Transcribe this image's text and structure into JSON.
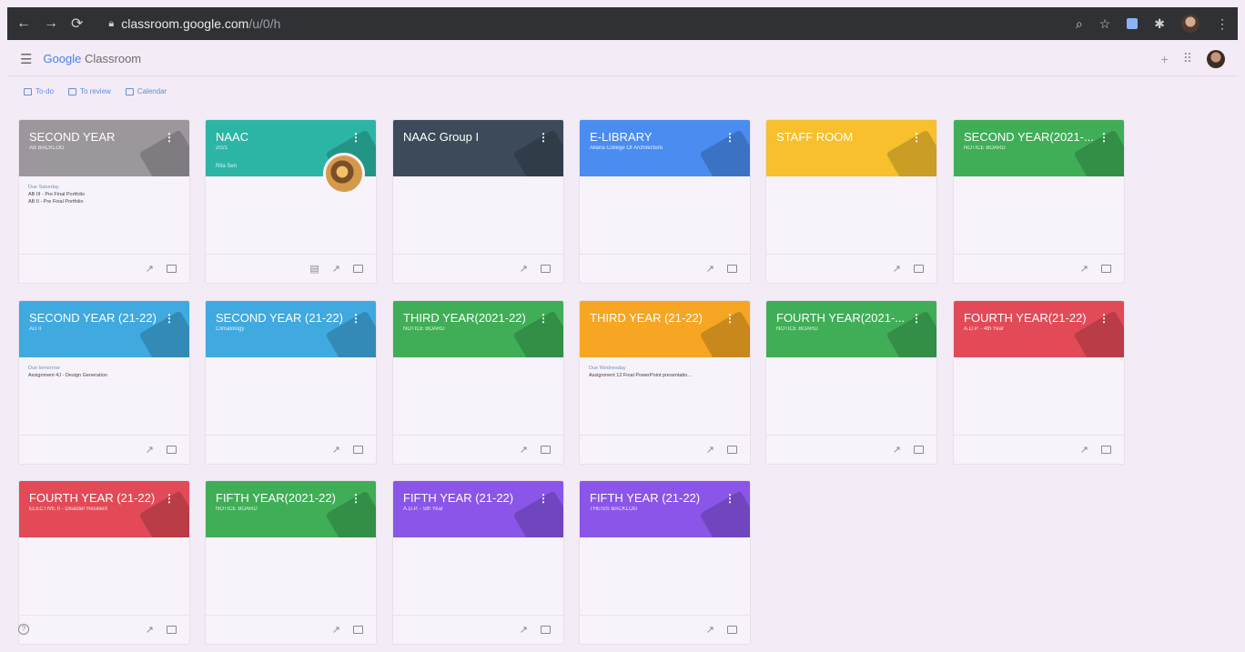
{
  "browser": {
    "url_main": "classroom.google.com",
    "url_rest": "/u/0/h"
  },
  "app": {
    "logo_google": "Google",
    "logo_classroom": "Classroom"
  },
  "subnav": {
    "todo": "To-do",
    "to_review": "To review",
    "calendar": "Calendar"
  },
  "colors": {
    "grey": "#9b979d",
    "teal": "#2cb5a5",
    "navy": "#3c4a5a",
    "blue": "#4a8cf0",
    "yellow": "#f7c02c",
    "green": "#3fae57",
    "lightblue": "#3fa9e0",
    "orange": "#f6a623",
    "red": "#e24a57",
    "purple": "#8a55e8"
  },
  "cards": [
    {
      "title": "SECOND YEAR",
      "sub": "AB BACKLOG",
      "sub2": "",
      "color": "#9b979d",
      "due": "Due Saturday",
      "lines": [
        "AB III - Pre Final Portfolio",
        "AB II - Pre Final Portfolio"
      ],
      "extra_icon": ""
    },
    {
      "title": "NAAC",
      "sub": "2021",
      "sub2": "Rita Sen",
      "color": "#2cb5a5",
      "due": "",
      "lines": [],
      "extra_icon": "assignment"
    },
    {
      "title": "NAAC Group I",
      "sub": "",
      "sub2": "",
      "color": "#3c4a5a",
      "due": "",
      "lines": [],
      "extra_icon": ""
    },
    {
      "title": "E-LIBRARY",
      "sub": "Allana College Of Architecture",
      "sub2": "",
      "color": "#4a8cf0",
      "due": "",
      "lines": [],
      "extra_icon": ""
    },
    {
      "title": "STAFF ROOM",
      "sub": "",
      "sub2": "",
      "color": "#f7c02c",
      "due": "",
      "lines": [],
      "extra_icon": ""
    },
    {
      "title": "SECOND YEAR(2021-...",
      "sub": "NOTICE BOARD",
      "sub2": "",
      "color": "#3fae57",
      "due": "",
      "lines": [],
      "extra_icon": ""
    },
    {
      "title": "SECOND YEAR (21-22)",
      "sub": "AD II",
      "sub2": "",
      "color": "#3fa9e0",
      "due": "Due tomorrow",
      "lines": [
        "Assignment 4J - Design Generation"
      ],
      "extra_icon": ""
    },
    {
      "title": "SECOND YEAR (21-22)",
      "sub": "Climatology",
      "sub2": "",
      "color": "#3fa9e0",
      "due": "",
      "lines": [],
      "extra_icon": ""
    },
    {
      "title": "THIRD YEAR(2021-22)",
      "sub": "NOTICE BOARD",
      "sub2": "",
      "color": "#3fae57",
      "due": "",
      "lines": [],
      "extra_icon": ""
    },
    {
      "title": "THIRD YEAR (21-22)",
      "sub": "",
      "sub2": "",
      "color": "#f6a623",
      "due": "Due Wednesday",
      "lines": [
        "Assignment 12 Final PowerPoint presentatio..."
      ],
      "extra_icon": ""
    },
    {
      "title": "FOURTH YEAR(2021-...",
      "sub": "NOTICE BOARD",
      "sub2": "",
      "color": "#3fae57",
      "due": "",
      "lines": [],
      "extra_icon": ""
    },
    {
      "title": "FOURTH YEAR(21-22)",
      "sub": "A.D.P. - 4th Year",
      "sub2": "",
      "color": "#e24a57",
      "due": "",
      "lines": [],
      "extra_icon": ""
    },
    {
      "title": "FOURTH YEAR (21-22)",
      "sub": "ELECTIVE II - Disaster Resilient",
      "sub2": "",
      "color": "#e24a57",
      "due": "",
      "lines": [],
      "extra_icon": ""
    },
    {
      "title": "FIFTH YEAR(2021-22)",
      "sub": "NOTICE BOARD",
      "sub2": "",
      "color": "#3fae57",
      "due": "",
      "lines": [],
      "extra_icon": ""
    },
    {
      "title": "FIFTH YEAR (21-22)",
      "sub": "A.D.P. - 5th Year",
      "sub2": "",
      "color": "#8a55e8",
      "due": "",
      "lines": [],
      "extra_icon": ""
    },
    {
      "title": "FIFTH YEAR (21-22)",
      "sub": "THESIS BACKLOG",
      "sub2": "",
      "color": "#8a55e8",
      "due": "",
      "lines": [],
      "extra_icon": ""
    }
  ]
}
